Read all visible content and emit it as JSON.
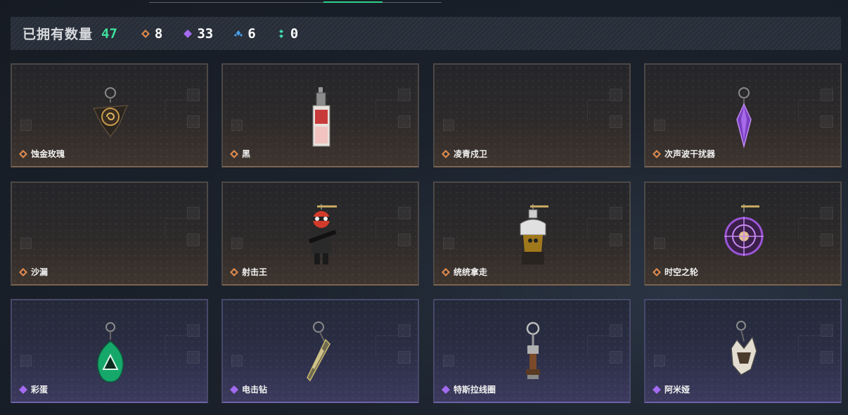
{
  "summary": {
    "title": "已拥有数量",
    "total": "47",
    "stats": [
      {
        "icon": "orange-diamond-icon",
        "color": "#e08a4a",
        "value": "8"
      },
      {
        "icon": "purple-diamond-icon",
        "color": "#a36bf0",
        "value": "33"
      },
      {
        "icon": "blue-diamond-icon",
        "color": "#4aa3f0",
        "value": "6"
      },
      {
        "icon": "green-diamond-icon",
        "color": "#3ee0b0",
        "value": "0"
      }
    ]
  },
  "cards": [
    {
      "name": "蚀金玫瑰",
      "rarity": "orange",
      "icon": "rose-pendant-icon"
    },
    {
      "name": "黑",
      "rarity": "orange",
      "icon": "card-pendant-icon"
    },
    {
      "name": "凌青戍卫",
      "rarity": "orange",
      "icon": ""
    },
    {
      "name": "次声波干扰器",
      "rarity": "orange",
      "icon": "crystal-pendant-icon"
    },
    {
      "name": "沙漏",
      "rarity": "orange",
      "icon": ""
    },
    {
      "name": "射击王",
      "rarity": "orange",
      "icon": "soldier-figure-icon"
    },
    {
      "name": "统统拿走",
      "rarity": "orange",
      "icon": "bandit-figure-icon"
    },
    {
      "name": "时空之轮",
      "rarity": "orange",
      "icon": "wheel-pendant-icon"
    },
    {
      "name": "彩蛋",
      "rarity": "purple",
      "icon": "green-egg-icon"
    },
    {
      "name": "电击钻",
      "rarity": "purple",
      "icon": "drill-pendant-icon"
    },
    {
      "name": "特斯拉线圈",
      "rarity": "purple",
      "icon": "tesla-coil-icon"
    },
    {
      "name": "阿米娅",
      "rarity": "purple",
      "icon": "fox-mask-icon"
    }
  ]
}
